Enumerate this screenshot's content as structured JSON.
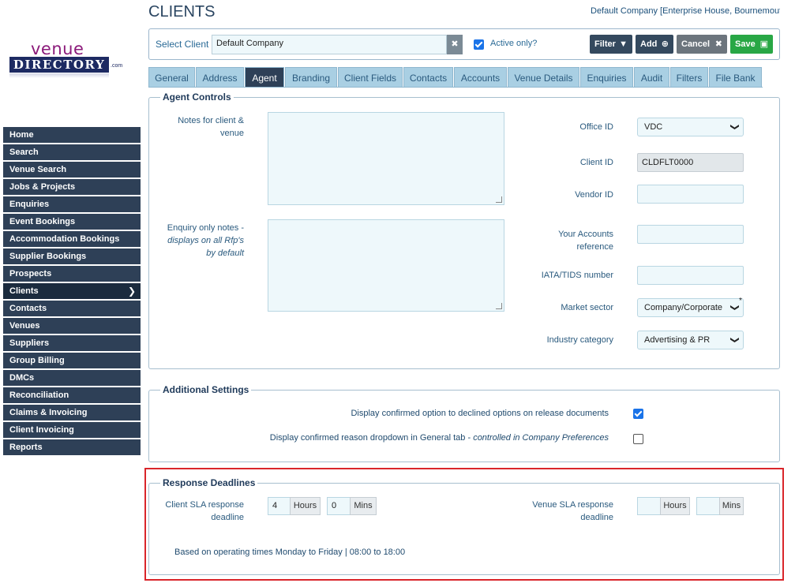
{
  "header": {
    "title": "CLIENTS",
    "company_link": "Default Company [Enterprise House, Bournemouth]"
  },
  "logo": {
    "top_text": "venue",
    "main_text": "DIRECTORY",
    "suffix": ".com"
  },
  "sidebar": {
    "items": [
      {
        "label": "Home"
      },
      {
        "label": "Search"
      },
      {
        "label": "Venue Search"
      },
      {
        "label": "Jobs & Projects"
      },
      {
        "label": "Enquiries"
      },
      {
        "label": "Event Bookings"
      },
      {
        "label": "Accommodation Bookings"
      },
      {
        "label": "Supplier Bookings"
      },
      {
        "label": "Prospects"
      },
      {
        "label": "Clients"
      },
      {
        "label": "Contacts"
      },
      {
        "label": "Venues"
      },
      {
        "label": "Suppliers"
      },
      {
        "label": "Group Billing"
      },
      {
        "label": "DMCs"
      },
      {
        "label": "Reconciliation"
      },
      {
        "label": "Claims & Invoicing"
      },
      {
        "label": "Client Invoicing"
      },
      {
        "label": "Reports"
      }
    ],
    "active": "Clients"
  },
  "client_bar": {
    "label": "Select Client",
    "value": "Default Company",
    "clear_glyph": "✖",
    "active_only_label": "Active only?",
    "active_only_checked": true,
    "buttons": {
      "filter": "Filter",
      "add": "Add",
      "cancel": "Cancel",
      "save": "Save"
    }
  },
  "tabs": [
    {
      "label": "General"
    },
    {
      "label": "Address"
    },
    {
      "label": "Agent"
    },
    {
      "label": "Branding"
    },
    {
      "label": "Client Fields"
    },
    {
      "label": "Contacts"
    },
    {
      "label": "Accounts"
    },
    {
      "label": "Venue Details"
    },
    {
      "label": "Enquiries"
    },
    {
      "label": "Audit"
    },
    {
      "label": "Filters"
    },
    {
      "label": "File Bank"
    }
  ],
  "active_tab": "Agent",
  "agent_controls": {
    "legend": "Agent Controls",
    "notes_label": "Notes for client & venue",
    "enquiry_notes_label": "Enquiry only notes -",
    "enquiry_notes_sub": "displays on all Rfp's by default",
    "office_id": {
      "label": "Office ID",
      "value": "VDC"
    },
    "client_id": {
      "label": "Client ID",
      "value": "CLDFLT0000"
    },
    "vendor_id": {
      "label": "Vendor ID",
      "value": ""
    },
    "accounts_ref": {
      "label": "Your Accounts reference",
      "value": ""
    },
    "iata": {
      "label": "IATA/TIDS number",
      "value": ""
    },
    "market_sector": {
      "label": "Market sector",
      "value": "Company/Corporate",
      "required": "*"
    },
    "industry_category": {
      "label": "Industry category",
      "value": "Advertising & PR"
    }
  },
  "additional_settings": {
    "legend": "Additional Settings",
    "opt1": {
      "label": "Display confirmed option to declined options on release documents",
      "checked": true
    },
    "opt2": {
      "label": "Display confirmed reason dropdown in General tab - ",
      "label_italic": "controlled in Company Preferences",
      "checked": false
    }
  },
  "response_deadlines": {
    "legend": "Response Deadlines",
    "client_sla_label": "Client SLA response deadline",
    "client_hours": "4",
    "client_mins": "0",
    "venue_sla_label": "Venue SLA response deadline",
    "venue_hours": "",
    "venue_mins": "",
    "hours_addon": "Hours",
    "mins_addon": "Mins",
    "note": "Based on operating times Monday to Friday | 08:00 to 18:00"
  },
  "colors": {
    "nav_bg": "#2e4057",
    "tab_bg": "#a9cfe3",
    "save_green": "#28a745",
    "highlight_red": "#d9252a"
  }
}
